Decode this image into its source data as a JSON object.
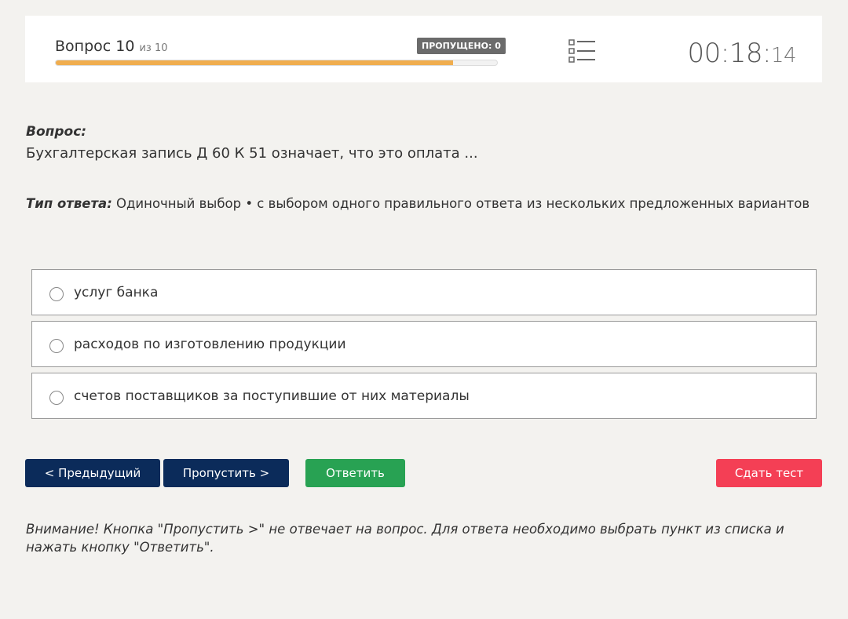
{
  "header": {
    "question_word": "Вопрос 10",
    "question_of": "из 10",
    "skipped_label": "ПРОПУЩЕНО: 0",
    "progress_fraction": 0.9,
    "timer_main": "00:18:",
    "timer_seconds": "14"
  },
  "question": {
    "label": "Вопрос:",
    "text": "Бухгалтерская запись Д 60 К 51 означает, что это оплата ...",
    "answer_type_label": "Тип ответа:",
    "answer_type_value": " Одиночный выбор • с выбором одного правильного ответа из нескольких предложенных вариантов"
  },
  "options": [
    {
      "label": "услуг банка"
    },
    {
      "label": "расходов по изготовлению продукции"
    },
    {
      "label": "счетов поставщиков за поступившие от них материалы"
    }
  ],
  "buttons": {
    "prev": "< Предыдущий",
    "skip": "Пропустить >",
    "answer": "Ответить",
    "submit": "Сдать тест"
  },
  "warning": "Внимание! Кнопка \"Пропустить >\" не отвечает на вопрос. Для ответа необходимо выбрать пункт из списка и нажать кнопку \"Ответить\".",
  "colors": {
    "progress": "#f0ad4e",
    "nav_button": "#0b2b5a",
    "answer_button": "#28a253",
    "submit_button": "#f43f55"
  },
  "icons": {
    "question_list": "list-icon"
  }
}
